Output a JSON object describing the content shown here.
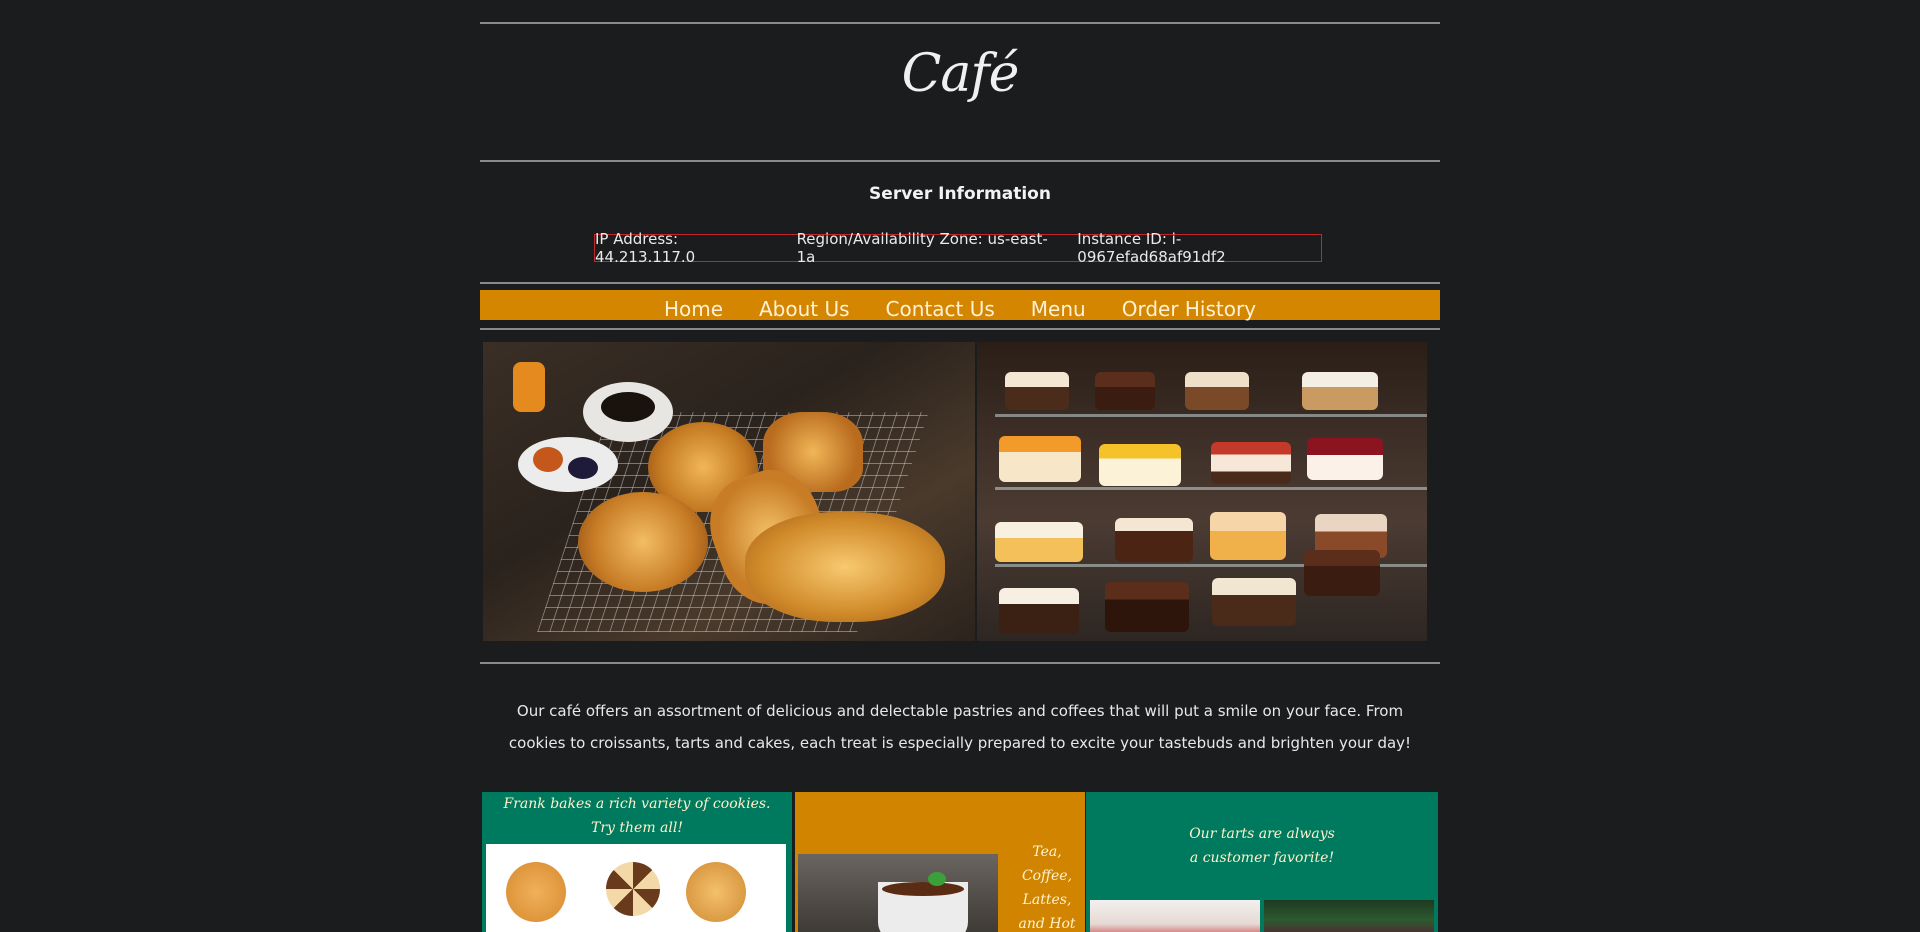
{
  "header": {
    "title": "Café"
  },
  "server": {
    "heading": "Server Information",
    "ip": "IP Address: 44.213.117.0",
    "region": "Region/Availability Zone: us-east-1a",
    "instance": "Instance ID: i-0967efad68af91df2"
  },
  "nav": {
    "items": [
      {
        "label": "Home"
      },
      {
        "label": "About Us"
      },
      {
        "label": "Contact Us"
      },
      {
        "label": "Menu"
      },
      {
        "label": "Order History"
      }
    ]
  },
  "hero": {
    "left_image": "pastries-and-coffee-photo",
    "right_image": "cake-display-case-photo"
  },
  "intro": {
    "text": "Our café offers an assortment of delicious and delectable pastries and coffees that will put a smile on your face. From cookies to croissants, tarts and cakes, each treat is especially prepared to excite your tastebuds and brighten your day!"
  },
  "tiles": {
    "cookies": {
      "caption": "Frank bakes a rich variety of cookies. Try them all!"
    },
    "drinks": {
      "caption_lines": [
        "Tea,",
        "Coffee,",
        "Lattes,",
        "and Hot"
      ]
    },
    "tarts": {
      "caption_lines": [
        "Our tarts are always",
        "a customer favorite!"
      ]
    }
  },
  "colors": {
    "background": "#1b1c1e",
    "nav_bar": "#d48600",
    "server_box_border": "#c0282c",
    "tile_green": "#007a5e",
    "tile_orange": "#d08400"
  }
}
